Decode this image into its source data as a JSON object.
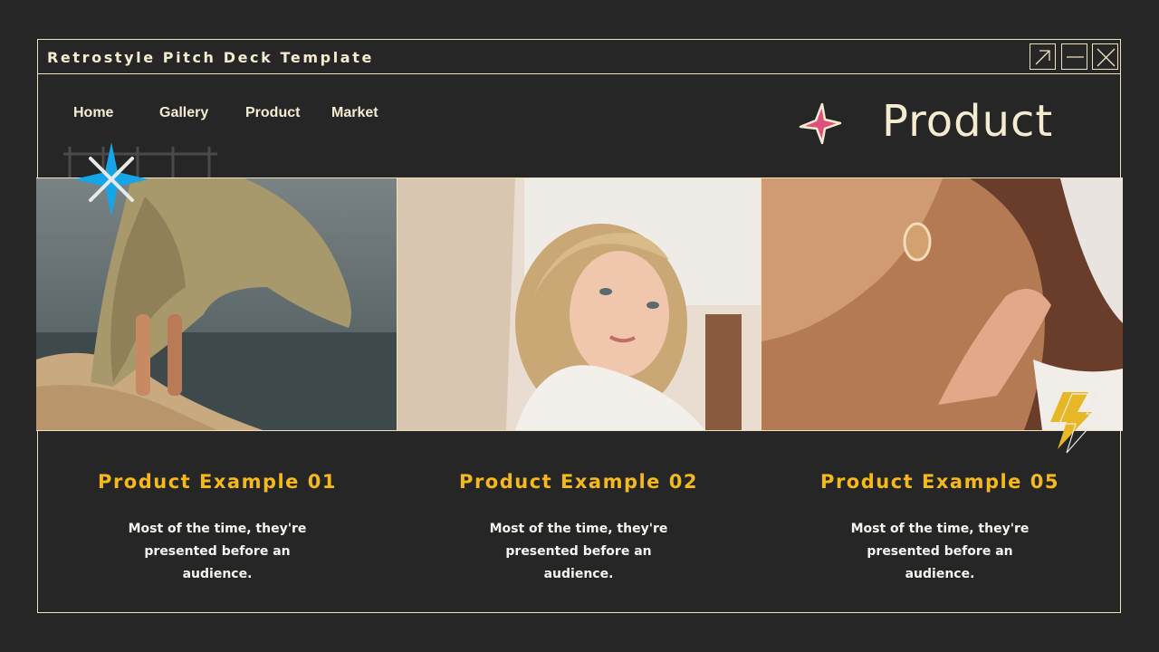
{
  "window": {
    "title": "Retrostyle Pitch Deck Template"
  },
  "nav": {
    "items": [
      "Home",
      "Gallery",
      "Product",
      "Market"
    ]
  },
  "heading": "Product",
  "cards": [
    {
      "title": "Product Example 01",
      "body": "Most of the time, they're presented before an audience."
    },
    {
      "title": "Product Example 02",
      "body": "Most of the time, they're presented before an audience."
    },
    {
      "title": "Product Example 05",
      "body": "Most of the time, they're presented before an audience."
    }
  ],
  "colors": {
    "background": "#262626",
    "frame": "#efe1bd",
    "accent_yellow": "#f6b91c",
    "star_blue": "#16a6e8",
    "star_pink": "#e0507e",
    "text_cream": "#f5ecd0"
  },
  "icons": [
    "expand-icon",
    "minimize-icon",
    "close-icon",
    "blue-sparkle-icon",
    "pink-star-icon",
    "lightning-icon"
  ]
}
